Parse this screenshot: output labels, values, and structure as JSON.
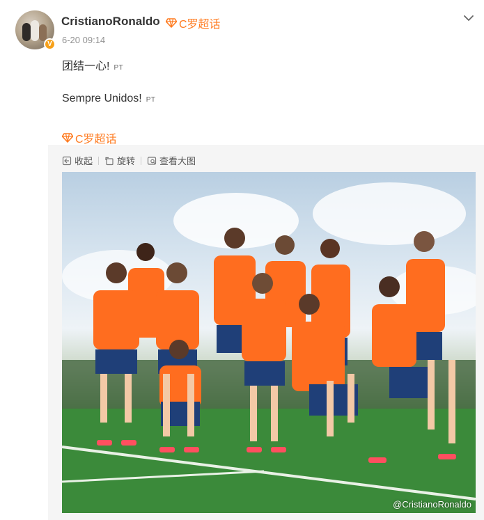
{
  "post": {
    "username": "CristianoRonaldo",
    "super_topic": "C罗超话",
    "timestamp": "6-20 09:14",
    "verified_badge": "V",
    "line1": "团结一心!",
    "line1_lang": "PT",
    "line2": "Sempre Unidos!",
    "line2_lang": "PT",
    "topic_link": "C罗超话"
  },
  "media_toolbar": {
    "collapse_label": "收起",
    "rotate_label": "旋转",
    "view_large_label": "查看大图"
  },
  "photo": {
    "watermark": "@CristianoRonaldo",
    "description_icons": [
      "team-photo"
    ]
  },
  "colors": {
    "accent_orange": "#ff7b20",
    "username": "#333333",
    "timestamp": "#939393",
    "verified": "#f7a11a"
  }
}
